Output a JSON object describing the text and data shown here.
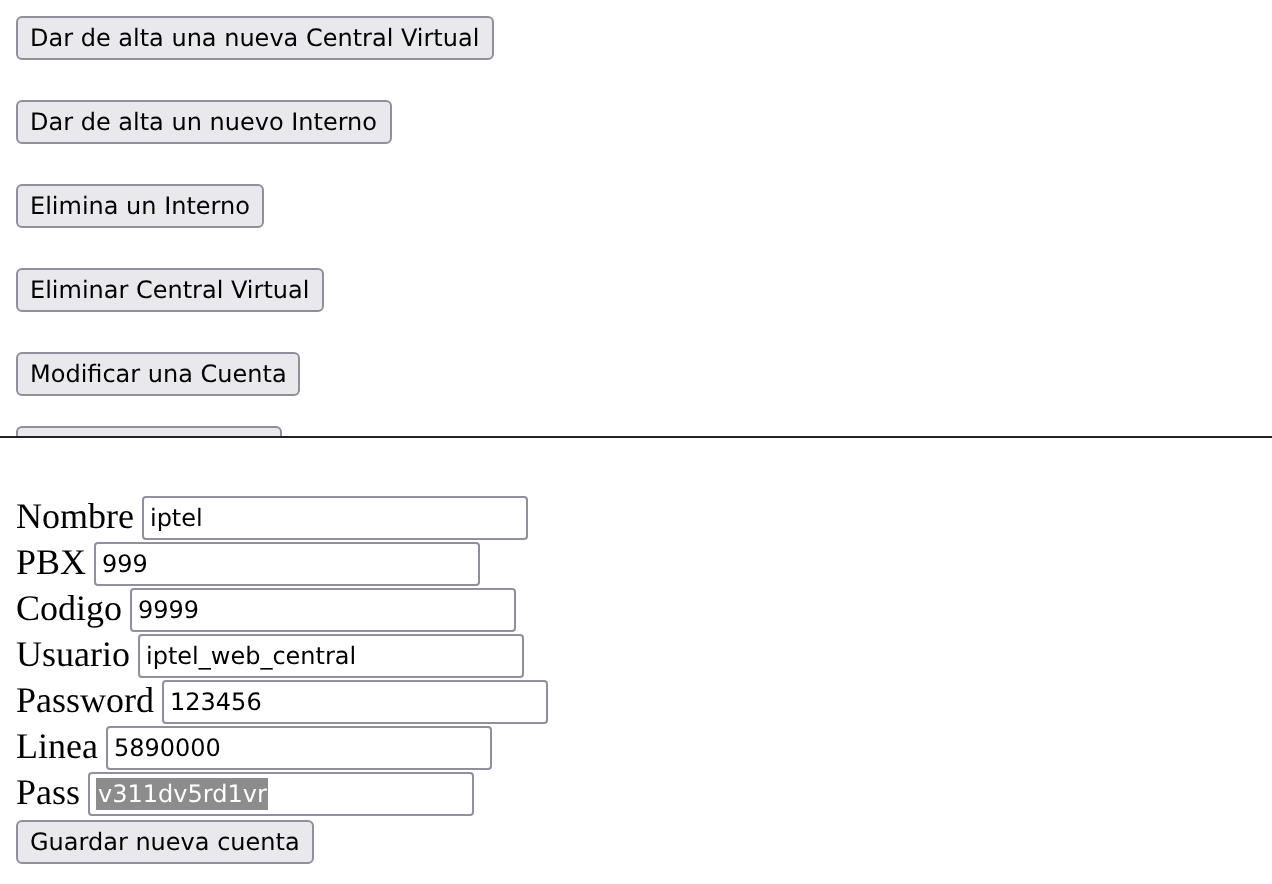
{
  "menu_buttons": [
    {
      "label": "Dar de alta una nueva Central Virtual"
    },
    {
      "label": "Dar de alta un nuevo Interno"
    },
    {
      "label": "Elimina un Interno"
    },
    {
      "label": "Eliminar Central Virtual"
    },
    {
      "label": "Modificar una Cuenta"
    }
  ],
  "menu_more_below": true,
  "form": {
    "fields": [
      {
        "label": "Nombre",
        "value": "iptel",
        "selected": false
      },
      {
        "label": "PBX",
        "value": "999",
        "selected": false
      },
      {
        "label": "Codigo",
        "value": "9999",
        "selected": false
      },
      {
        "label": "Usuario",
        "value": "iptel_web_central",
        "selected": false
      },
      {
        "label": "Password",
        "value": "123456",
        "selected": false
      },
      {
        "label": "Linea",
        "value": "5890000",
        "selected": false
      },
      {
        "label": "Pass",
        "value": "v311dv5rd1vr",
        "selected": true
      }
    ],
    "submit": "Guardar nueva cuenta"
  }
}
